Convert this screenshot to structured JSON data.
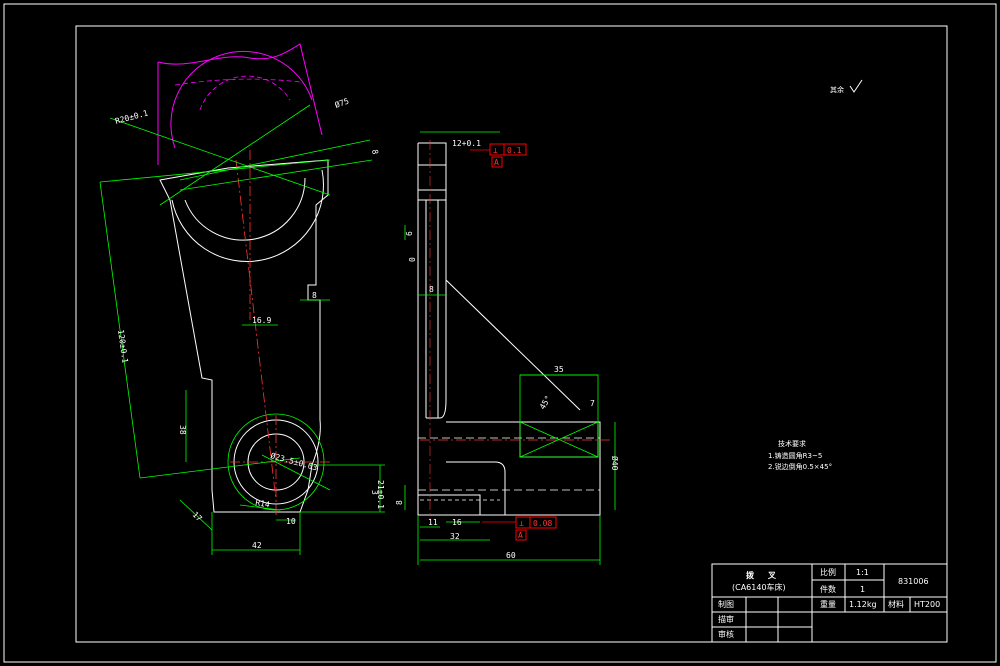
{
  "drawing": {
    "surface_note": "其余",
    "tech_requirements": {
      "title": "技术要求",
      "items": [
        "1.铸造圆角R3~5",
        "2.锐边倒角0.5×45°"
      ]
    },
    "front_view_dims": {
      "arm_length": "120±0.1",
      "top_slot": "Ø75",
      "top_radius": "R20±0.1",
      "top_thk": "8",
      "web_width": "16.9",
      "step": "8",
      "lower_height": "38",
      "bore_dia": "Ø23.5±0.03",
      "bore_r": "R14",
      "base_height": "3",
      "base_height2": "21±0.1",
      "chamfer": "17",
      "offset10": "10",
      "width42": "42"
    },
    "side_view_dims": {
      "top_tol": "12+0.1",
      "top_small": "6",
      "slot_w": "0",
      "hole_w": "8",
      "boss_w": "35",
      "boss_small": "7",
      "boss_h": "Ø40",
      "rib": "45°",
      "base_small": "8",
      "d11": "11",
      "d16": "16",
      "d32": "32",
      "d60": "60",
      "d8": "8"
    },
    "gdt": [
      {
        "symbol": "⊥",
        "value": "0.1",
        "datum": "A"
      },
      {
        "symbol": "⊥",
        "value": "0.08",
        "datum": "A"
      }
    ],
    "title_block": {
      "part_name": "拨叉",
      "machine": "(CA6140车床)",
      "scale_label": "比例",
      "scale_value": "1:1",
      "qty_label": "件数",
      "qty_value": "1",
      "drawing_no": "831006",
      "weight_label": "重量",
      "weight_value": "1.12kg",
      "material_label": "材料",
      "material_value": "HT200",
      "drawn_label": "制图",
      "design_label": "描审",
      "check_label": "审核"
    },
    "colors": {
      "outline": "#ffffff",
      "dimension": "#00ff00",
      "centerline": "#ff3333",
      "phantom": "#ff00ff",
      "gdt_box": "#ff0000"
    }
  }
}
